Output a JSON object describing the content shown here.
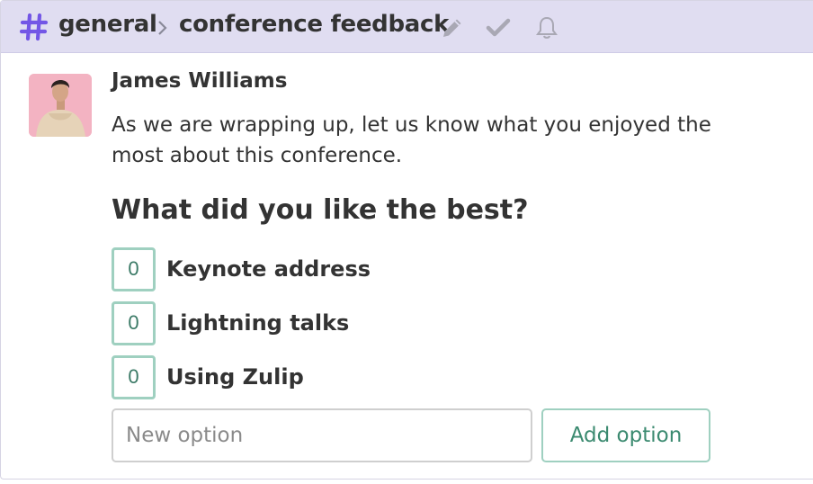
{
  "header": {
    "stream": "general",
    "topic": "conference feedback",
    "stream_color": "#7356e6",
    "icons": [
      "hash-icon",
      "chevron-right-icon",
      "pencil-icon",
      "check-icon",
      "bell-icon"
    ]
  },
  "message": {
    "sender": "James Williams",
    "avatar": "avatar-photo",
    "text": "As we are wrapping up, let us know what you enjoyed the most about this conference."
  },
  "poll": {
    "question": "What did you like the best?",
    "options": [
      {
        "votes": "0",
        "label": "Keynote address"
      },
      {
        "votes": "0",
        "label": "Lightning talks"
      },
      {
        "votes": "0",
        "label": "Using Zulip"
      }
    ],
    "new_option_placeholder": "New option",
    "add_option_label": "Add option",
    "accent_color": "#9fd0c0"
  }
}
